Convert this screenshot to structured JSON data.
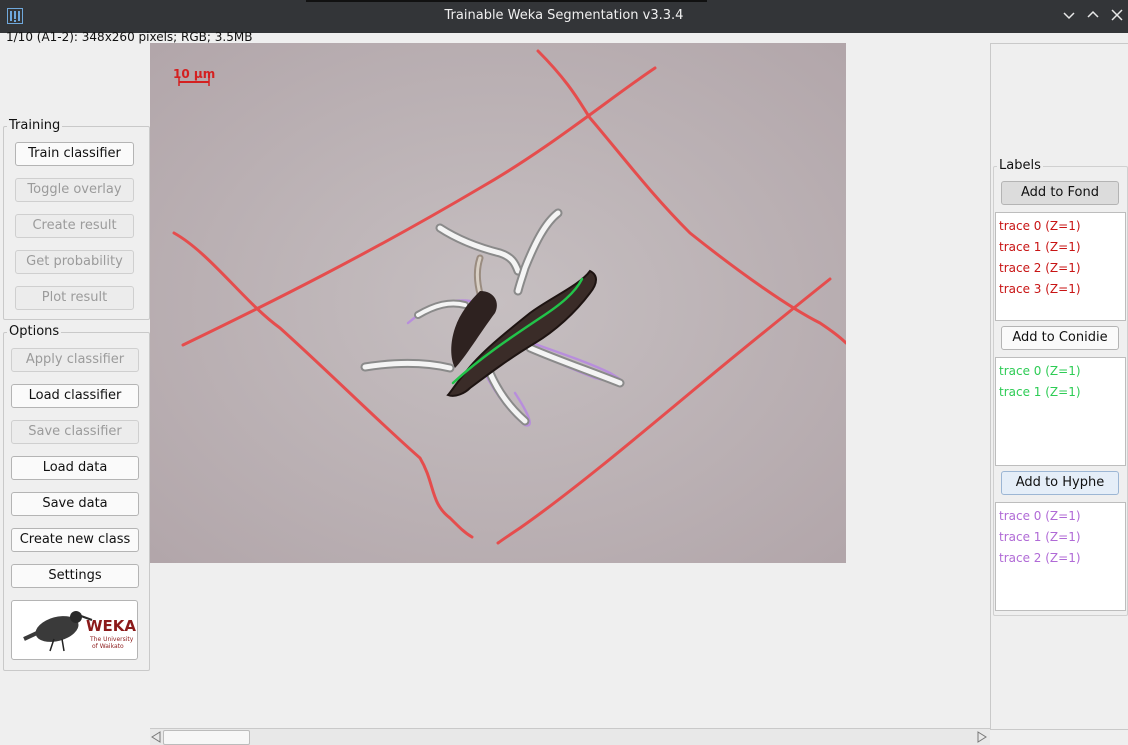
{
  "window": {
    "title": "Trainable Weka Segmentation v3.3.4",
    "controls": [
      "chevron-down-icon",
      "chevron-up-icon",
      "close-icon"
    ]
  },
  "image_info": "1/10 (A1-2): 348x260 pixels; RGB; 3.5MB",
  "scale_bar": "10 µm",
  "training": {
    "title": "Training",
    "buttons": [
      {
        "label": "Train classifier",
        "enabled": true
      },
      {
        "label": "Toggle overlay",
        "enabled": false
      },
      {
        "label": "Create result",
        "enabled": false
      },
      {
        "label": "Get probability",
        "enabled": false
      },
      {
        "label": "Plot result",
        "enabled": false
      }
    ]
  },
  "options": {
    "title": "Options",
    "buttons": [
      {
        "label": "Apply classifier",
        "enabled": false
      },
      {
        "label": "Load classifier",
        "enabled": true
      },
      {
        "label": "Save classifier",
        "enabled": false
      },
      {
        "label": "Load data",
        "enabled": true
      },
      {
        "label": "Save data",
        "enabled": true
      },
      {
        "label": "Create new class",
        "enabled": true
      },
      {
        "label": "Settings",
        "enabled": true
      }
    ]
  },
  "weka_logo": {
    "name": "WEKA",
    "line1": "The University",
    "line2": "of Waikato"
  },
  "labels": {
    "title": "Labels",
    "classes": [
      {
        "button": "Add to Fond",
        "color": "#c81414",
        "traces": [
          "trace 0 (Z=1)",
          "trace 1 (Z=1)",
          "trace 2 (Z=1)",
          "trace 3 (Z=1)"
        ]
      },
      {
        "button": "Add to Conidie",
        "color": "#2ecc55",
        "traces": [
          "trace 0 (Z=1)",
          "trace 1 (Z=1)"
        ]
      },
      {
        "button": "Add to Hyphe",
        "color": "#b06ad6",
        "traces": [
          "trace 0 (Z=1)",
          "trace 1 (Z=1)",
          "trace 2 (Z=1)"
        ]
      }
    ]
  },
  "colors": {
    "titlebar": "#333538",
    "fond_trace": "#e84848",
    "conidie_trace": "#22c44a",
    "hyphe_trace": "#b88ae0",
    "image_background": "#bbb4b6"
  }
}
